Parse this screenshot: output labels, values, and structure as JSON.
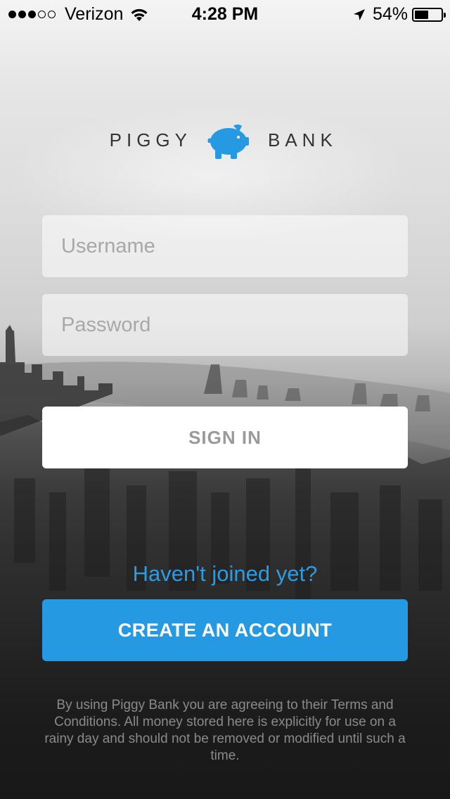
{
  "status_bar": {
    "signal_filled": 3,
    "signal_total": 5,
    "carrier": "Verizon",
    "time": "4:28 PM",
    "battery_percent": "54%",
    "battery_level": 0.54,
    "icons": [
      "wifi-icon",
      "location-arrow-icon",
      "battery-icon"
    ]
  },
  "logo": {
    "left_text": "PIGGY",
    "right_text": "BANK",
    "icon": "piggy-bank-icon",
    "icon_color": "#259ae2"
  },
  "login_form": {
    "username_placeholder": "Username",
    "password_placeholder": "Password",
    "sign_in_label": "SIGN IN"
  },
  "signup": {
    "prompt": "Haven't joined yet?",
    "create_account_label": "CREATE AN ACCOUNT"
  },
  "terms_text": "By using Piggy Bank you are agreeing to their Terms and Conditions. All money stored here is explicitly for use on a rainy day and should not be removed or modified until such a time.",
  "colors": {
    "accent": "#259ae2",
    "link": "#2a9ce5"
  }
}
